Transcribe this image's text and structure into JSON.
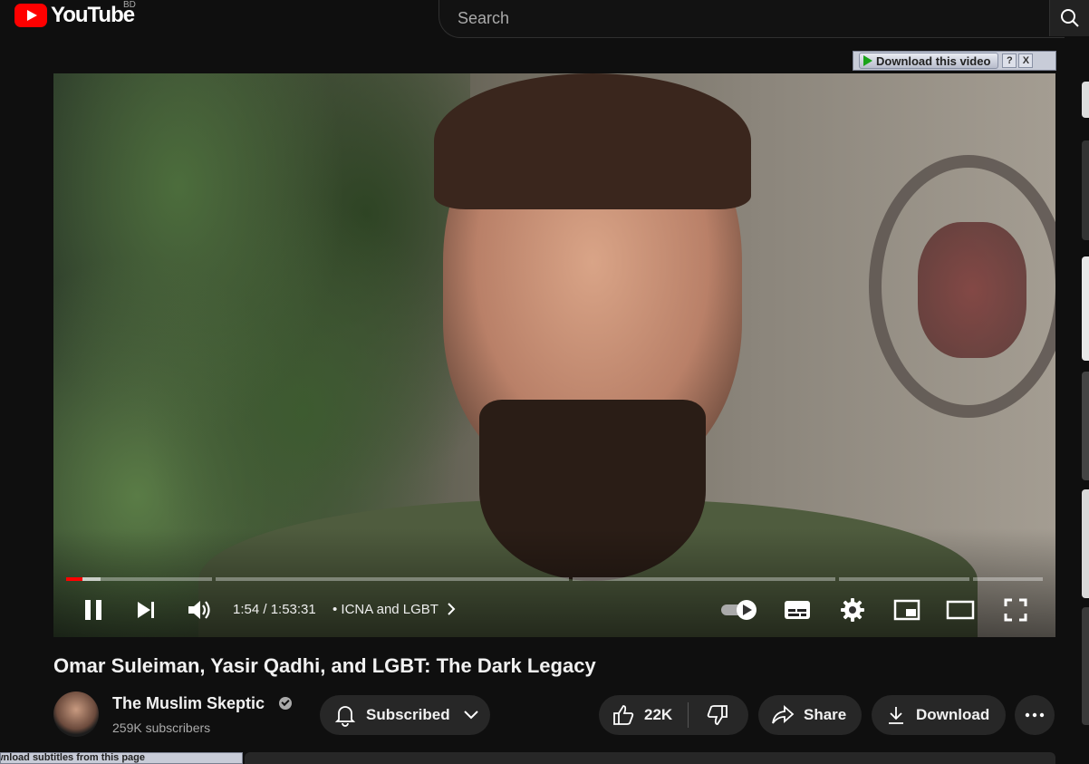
{
  "header": {
    "logo_text": "YouTube",
    "country_code": "BD",
    "search_placeholder": "Search"
  },
  "extension": {
    "download_video_label": "Download this video",
    "help_label": "?",
    "close_label": "X",
    "subtitles_label": "wnload subtitles from this page"
  },
  "player": {
    "time": "1:54 / 1:53:31",
    "chapter": "• ICNA and LGBT",
    "progress_fraction": 0.0167,
    "state": "playing"
  },
  "video": {
    "title": "Omar Suleiman, Yasir Qadhi, and LGBT: The Dark Legacy",
    "channel_name": "The Muslim Skeptic",
    "subscribers": "259K subscribers",
    "subscribe_label": "Subscribed",
    "like_count": "22K",
    "share_label": "Share",
    "download_label": "Download"
  },
  "colors": {
    "accent": "#ff0000",
    "background": "#0f0f0f",
    "pill": "#272727"
  }
}
